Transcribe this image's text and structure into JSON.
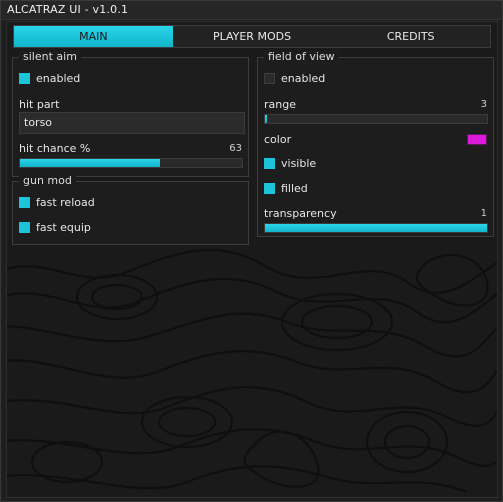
{
  "window": {
    "title": "ALCATRAZ UI - v1.0.1"
  },
  "tabs": [
    {
      "label": "MAIN",
      "active": true
    },
    {
      "label": "PLAYER MODS",
      "active": false
    },
    {
      "label": "CREDITS",
      "active": false
    }
  ],
  "silent_aim": {
    "title": "silent aim",
    "enabled": {
      "label": "enabled",
      "checked": true
    },
    "hit_part": {
      "label": "hit part",
      "value": "torso"
    },
    "hit_chance": {
      "label": "hit chance %",
      "value": "63",
      "fraction": 0.63
    }
  },
  "gun_mod": {
    "title": "gun mod",
    "fast_reload": {
      "label": "fast reload",
      "checked": true
    },
    "fast_equip": {
      "label": "fast equip",
      "checked": true
    }
  },
  "field_of_view": {
    "title": "field of view",
    "enabled": {
      "label": "enabled",
      "checked": false
    },
    "range": {
      "label": "range",
      "value": "3",
      "fraction": 0.01
    },
    "color": {
      "label": "color",
      "hex": "#d91ad9"
    },
    "visible": {
      "label": "visible",
      "checked": true
    },
    "filled": {
      "label": "filled",
      "checked": true
    },
    "transparency": {
      "label": "transparency",
      "value": "1",
      "fraction": 1.0
    }
  },
  "colors": {
    "accent": "#1cc4da",
    "background": "#1a1a1a",
    "fov_color": "#d91ad9"
  }
}
